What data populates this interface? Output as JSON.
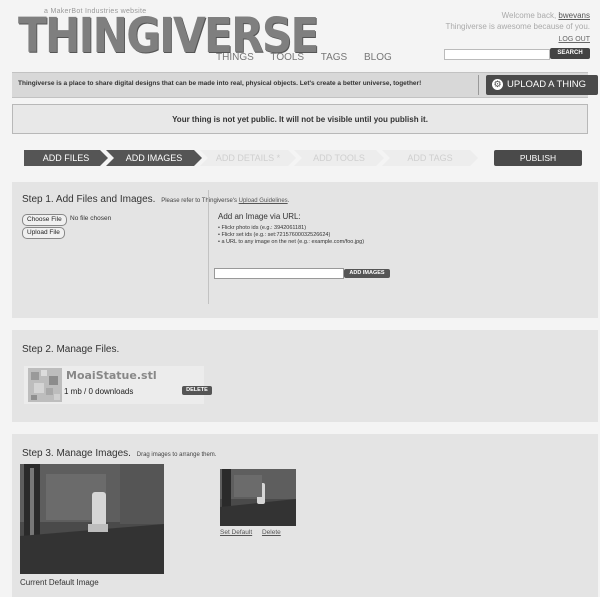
{
  "header": {
    "tagline": "a MakerBot Industries website",
    "logo": "THINGIVERSE",
    "nav": [
      "THINGS",
      "TOOLS",
      "TAGS",
      "BLOG"
    ],
    "welcome_prefix": "Welcome back,",
    "username": "bwevans",
    "welcome_line2": "Thingiverse is awesome because of you.",
    "logout": "LOG OUT",
    "search_button": "SEARCH"
  },
  "bar": {
    "text": "Thingiverse is a place to share digital designs that can be made into real, physical objects. Let's create a better universe, together!",
    "upload_button": "UPLOAD A THING"
  },
  "notice": "Your thing is not yet public. It will not be visible until you publish it.",
  "steps": [
    {
      "label": "ADD FILES"
    },
    {
      "label": "ADD IMAGES"
    },
    {
      "label": "ADD DETAILS *"
    },
    {
      "label": "ADD TOOLS"
    },
    {
      "label": "ADD TAGS"
    }
  ],
  "publish": "PUBLISH",
  "step1": {
    "title": "Step 1. Add Files and Images.",
    "hint_prefix": "Please refer to Thingiverse's",
    "hint_link": "Upload Guidelines",
    "choose_file": "Choose File",
    "no_file": "No file chosen",
    "upload_file": "Upload File",
    "url_title": "Add an Image via URL:",
    "url_items": [
      "Flickr photo ids (e.g.: 3942061181)",
      "Flickr set ids (e.g.: set:72157600032526624)",
      "a URL to any image on the net (e.g.: example.com/foo.jpg)"
    ],
    "add_images_button": "ADD IMAGES"
  },
  "step2": {
    "title": "Step 2. Manage Files.",
    "file_name": "MoaiStatue.stl",
    "file_meta": "1 mb / 0 downloads",
    "delete_button": "DELETE"
  },
  "step3": {
    "title": "Step 3. Manage Images.",
    "hint": "Drag images to arrange them.",
    "caption": "Current Default Image",
    "set_default": "Set Default",
    "delete": "Delete"
  }
}
